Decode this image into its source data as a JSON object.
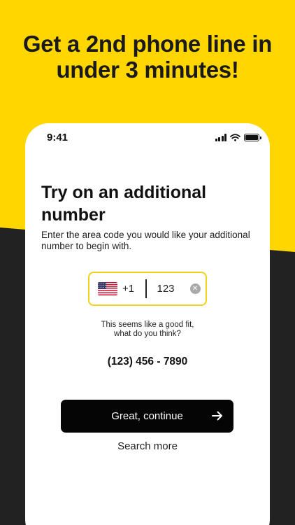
{
  "headline": {
    "line1": "Get a 2nd phone line in",
    "line2": "under 3 minutes!"
  },
  "phone": {
    "status_bar": {
      "time": "9:41",
      "icons": [
        "signal-icon",
        "wifi-icon",
        "battery-icon"
      ]
    },
    "title": {
      "line1": "Try on an additional",
      "line2": "number"
    },
    "description": "Enter the area code you would like your additional number to begin with.",
    "number_input": {
      "flag_icon": "us-flag-icon",
      "dial_code": "+1",
      "area_code": "123",
      "clear_icon": "clear-circle-x-icon"
    },
    "suggestion": {
      "line1": "This seems like a good fit,",
      "line2": "what do you think?"
    },
    "suggested_number": "(123) 456 - 7890",
    "continue_button": {
      "label": "Great, continue",
      "icon": "arrow-right-icon"
    },
    "search_more_label": "Search more"
  },
  "colors": {
    "brand_yellow": "#FFD600",
    "dark_background": "#222222",
    "input_border": "#F2D21B",
    "button_background": "#050505"
  }
}
